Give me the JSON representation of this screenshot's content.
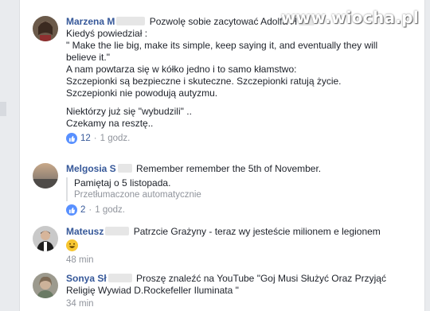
{
  "watermark": "www.wiocha.pl",
  "comments": [
    {
      "name": "Marzena M",
      "lines": [
        "Pozwolę sobie zacytować Adolfa H",
        "Kiedyś powiedział :",
        "\" Make the lie big, make its simple, keep saying it, and eventually they will",
        "believe it.\"",
        "A nam powtarza się w kółko jedno i to samo kłamstwo:",
        "Szczepionki są bezpieczne i skuteczne. Szczepionki ratują życie.",
        "Szczepionki nie powodują autyzmu.",
        "",
        "Niektórzy już się \"wybudzili\" ..",
        "Czekamy na resztę.."
      ],
      "likes": "12",
      "time": "1 godz."
    },
    {
      "name": "Melgosia S",
      "text": "Remember remember the 5th of November.",
      "translation": "Pamiętaj o 5 listopada.",
      "translation_note": "Przetłumaczone automatycznie",
      "likes": "2",
      "time": "1 godz."
    },
    {
      "name": "Mateusz",
      "text": "Patrzcie Grażyny - teraz wy jesteście milionem e legionem",
      "time": "48 min"
    },
    {
      "name": "Sonya Sł",
      "lines": [
        "Proszę znaleźć na YouTube \"Goj Musi Służyć Oraz Przyjąć",
        "Religię Wywiad D.Rockefeller Iluminata \""
      ],
      "time": "34 min"
    }
  ],
  "separator": "·",
  "icons": {
    "like": "thumbs-up-icon",
    "emoji": "grinning-face-icon"
  },
  "colors": {
    "name": "#365899",
    "like": "#5890ff",
    "meta": "#90949c"
  }
}
